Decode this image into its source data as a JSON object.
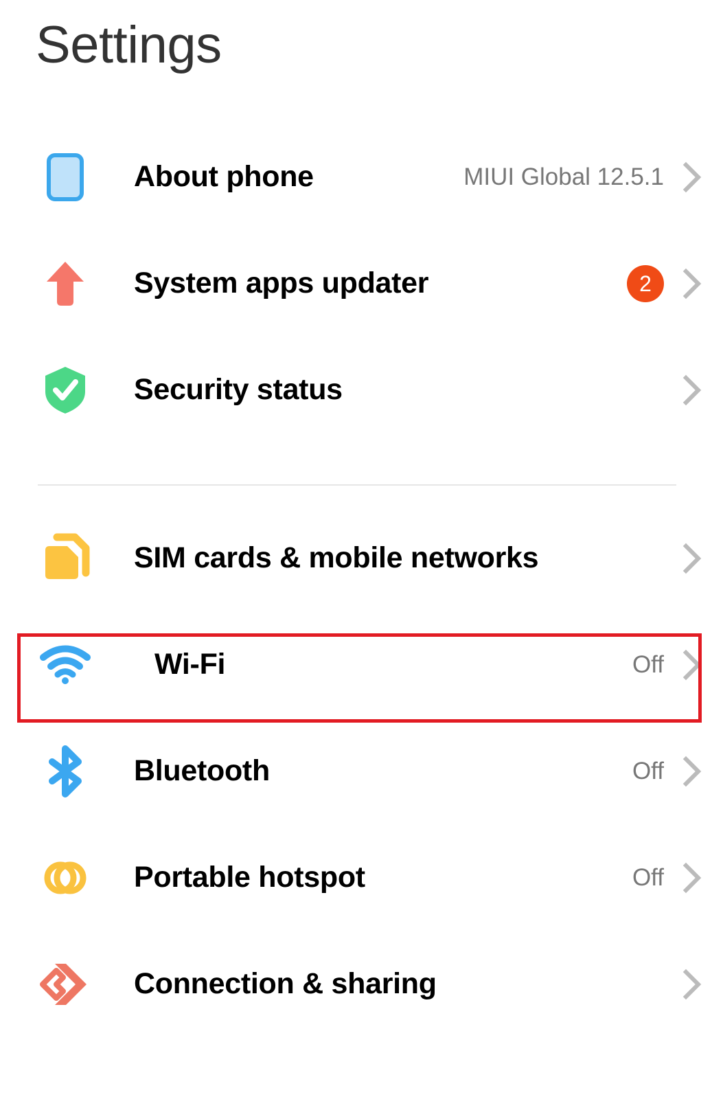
{
  "header": {
    "title": "Settings"
  },
  "groups": [
    {
      "name": "device-group",
      "items": [
        {
          "label": "About phone",
          "value": "MIUI Global 12.5.1",
          "badge": null,
          "icon": "phone-icon",
          "name": "about-phone"
        },
        {
          "label": "System apps updater",
          "value": null,
          "badge": "2",
          "icon": "up-arrow-icon",
          "name": "system-apps-updater"
        },
        {
          "label": "Security status",
          "value": null,
          "badge": null,
          "icon": "shield-check-icon",
          "name": "security-status"
        }
      ]
    },
    {
      "name": "connectivity-group",
      "items": [
        {
          "label": "SIM cards & mobile networks",
          "value": null,
          "badge": null,
          "icon": "sim-cards-icon",
          "name": "sim-cards-mobile-networks"
        },
        {
          "label": "Wi-Fi",
          "value": "Off",
          "badge": null,
          "icon": "wifi-icon",
          "name": "wifi",
          "highlighted": true
        },
        {
          "label": "Bluetooth",
          "value": "Off",
          "badge": null,
          "icon": "bluetooth-icon",
          "name": "bluetooth"
        },
        {
          "label": "Portable hotspot",
          "value": "Off",
          "badge": null,
          "icon": "hotspot-icon",
          "name": "portable-hotspot"
        },
        {
          "label": "Connection & sharing",
          "value": null,
          "badge": null,
          "icon": "connection-sharing-icon",
          "name": "connection-sharing"
        }
      ]
    }
  ],
  "colors": {
    "about_phone_icon": "#3BA7EC",
    "updater_icon": "#F5776A",
    "security_icon": "#4CD787",
    "sim_icon": "#FCC441",
    "wifi_icon": "#3BA7F0",
    "bluetooth_icon": "#3BA7F0",
    "hotspot_icon": "#FAC23F",
    "connection_icon": "#EE7763",
    "badge_background": "#F04B16",
    "highlight_border": "#E21B23",
    "value_text": "#777777",
    "chevron": "#BBBBBB",
    "title_text": "#333333"
  }
}
